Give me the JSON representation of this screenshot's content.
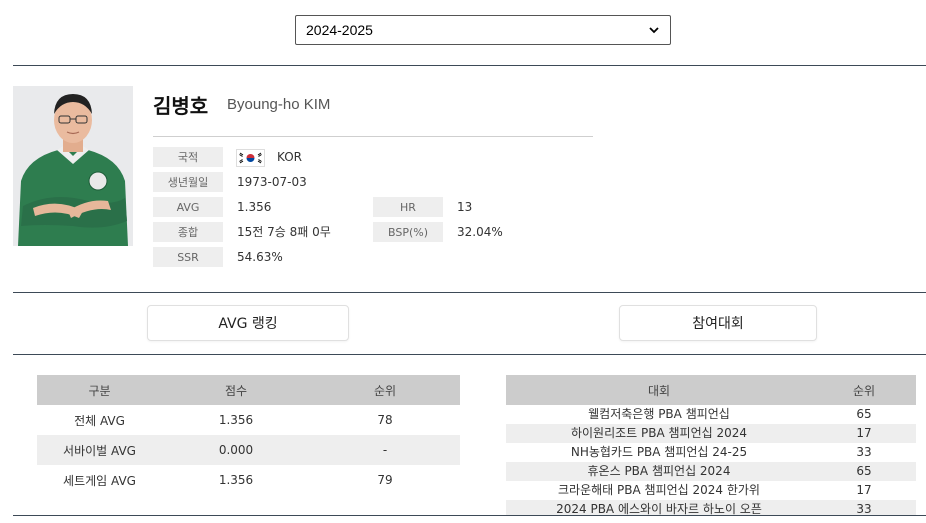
{
  "season_select": {
    "selected": "2024-2025"
  },
  "player": {
    "name_ko": "김병호",
    "name_en": "Byoung-ho KIM"
  },
  "profile": {
    "nationality": {
      "label": "국적",
      "value": "KOR"
    },
    "birth": {
      "label": "생년월일",
      "value": "1973-07-03"
    },
    "avg": {
      "label": "AVG",
      "value": "1.356"
    },
    "hr": {
      "label": "HR",
      "value": "13"
    },
    "overall": {
      "label": "종합",
      "value": "15전 7승 8패 0무"
    },
    "bsp": {
      "label": "BSP(%)",
      "value": "32.04%"
    },
    "ssr": {
      "label": "SSR",
      "value": "54.63%"
    }
  },
  "sections": {
    "avg_ranking": "AVG 랭킹",
    "tournaments": "참여대회"
  },
  "avg_table": {
    "headers": [
      "구분",
      "점수",
      "순위"
    ],
    "rows": [
      [
        "전체 AVG",
        "1.356",
        "78"
      ],
      [
        "서바이벌 AVG",
        "0.000",
        "-"
      ],
      [
        "세트게임 AVG",
        "1.356",
        "79"
      ]
    ]
  },
  "tournament_table": {
    "headers": [
      "대회",
      "순위"
    ],
    "rows": [
      [
        "웰컴저축은행 PBA 챔피언십",
        "65"
      ],
      [
        "하이원리조트 PBA 챔피언십 2024",
        "17"
      ],
      [
        "NH농협카드 PBA 챔피언십 24-25",
        "33"
      ],
      [
        "휴온스 PBA 챔피언십 2024",
        "65"
      ],
      [
        "크라운해태 PBA 챔피언십 2024 한가위",
        "17"
      ],
      [
        "2024 PBA 에스와이 바자르 하노이 오픈",
        "33"
      ]
    ]
  },
  "colors": {
    "rule": "#3d4a57",
    "header_bg": "#cccccc",
    "label_bg": "#eeeeee",
    "shirt": "#2e7d4f"
  }
}
